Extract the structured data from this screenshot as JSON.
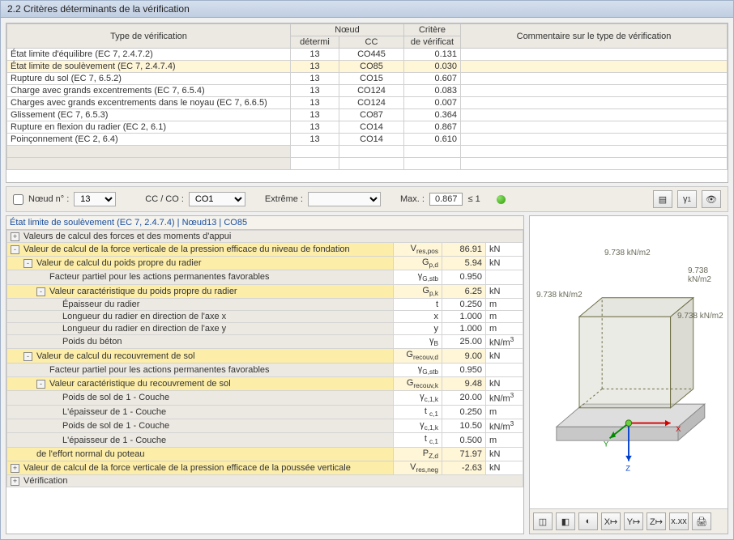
{
  "title": "2.2 Critères déterminants de la vérification",
  "table_headers": {
    "type": "Type de vérification",
    "noeud": "Nœud",
    "determi": "détermi",
    "cc": "CC",
    "critere": "Critère",
    "de_verificat": "de vérificat",
    "commentaire": "Commentaire sur le type de vérification"
  },
  "rows": [
    {
      "type": "État limite d'équilibre (EC 7, 2.4.7.2)",
      "det": "13",
      "cc": "CO445",
      "crit": "0.131",
      "hl": false
    },
    {
      "type": "État limite de soulèvement (EC 7, 2.4.7.4)",
      "det": "13",
      "cc": "CO85",
      "crit": "0.030",
      "hl": true
    },
    {
      "type": "Rupture du sol (EC 7, 6.5.2)",
      "det": "13",
      "cc": "CO15",
      "crit": "0.607",
      "hl": false
    },
    {
      "type": "Charge avec grands excentrements (EC 7, 6.5.4)",
      "det": "13",
      "cc": "CO124",
      "crit": "0.083",
      "hl": false
    },
    {
      "type": "Charges avec grands excentrements dans le noyau (EC 7, 6.6.5)",
      "det": "13",
      "cc": "CO124",
      "crit": "0.007",
      "hl": false
    },
    {
      "type": "Glissement (EC 7, 6.5.3)",
      "det": "13",
      "cc": "CO87",
      "crit": "0.364",
      "hl": false
    },
    {
      "type": "Rupture en flexion du radier (EC 2, 6.1)",
      "det": "13",
      "cc": "CO14",
      "crit": "0.867",
      "hl": false
    },
    {
      "type": "Poinçonnement (EC 2, 6.4)",
      "det": "13",
      "cc": "CO14",
      "crit": "0.610",
      "hl": false
    }
  ],
  "filter": {
    "noeud_label": "Nœud n° :",
    "noeud_value": "13",
    "cc_label": "CC / CO :",
    "cc_value": "CO1",
    "extreme_label": "Extrême :",
    "extreme_value": "",
    "max_label": "Max. :",
    "max_value": "0.867",
    "max_limit": "≤ 1"
  },
  "details_header": "État limite de soulèvement (EC 7, 2.4.7.4) | Nœud13 | CO85",
  "details": [
    {
      "indent": 0,
      "tw": "+",
      "label": "Valeurs de calcul des forces et des moments d'appui"
    },
    {
      "indent": 0,
      "tw": "-",
      "label": "Valeur de calcul de la force verticale de la pression efficace du niveau de fondation",
      "sym_html": "V<sub>res,pos</sub>",
      "val": "86.91",
      "unit": "kN",
      "hl": true
    },
    {
      "indent": 1,
      "tw": "-",
      "label": "Valeur de calcul du poids propre du radier",
      "sym_html": "G<sub>p,d</sub>",
      "val": "5.94",
      "unit": "kN",
      "hl": true
    },
    {
      "indent": 2,
      "tw": "",
      "label": "Facteur partiel pour les actions permanentes favorables",
      "sym_html": "γ<sub>G,stb</sub>",
      "val": "0.950",
      "unit": ""
    },
    {
      "indent": 2,
      "tw": "-",
      "label": "Valeur caractéristique du poids propre du radier",
      "sym_html": "G<sub>p,k</sub>",
      "val": "6.25",
      "unit": "kN",
      "hl": true
    },
    {
      "indent": 3,
      "tw": "",
      "label": "Épaisseur du radier",
      "sym_html": "t",
      "val": "0.250",
      "unit": "m"
    },
    {
      "indent": 3,
      "tw": "",
      "label": "Longueur du radier en direction de l'axe x",
      "sym_html": "x",
      "val": "1.000",
      "unit": "m"
    },
    {
      "indent": 3,
      "tw": "",
      "label": "Longueur du radier en direction de l'axe y",
      "sym_html": "y",
      "val": "1.000",
      "unit": "m"
    },
    {
      "indent": 3,
      "tw": "",
      "label": "Poids du béton",
      "sym_html": "γ<sub>B</sub>",
      "val": "25.00",
      "unit_html": "kN/m<sup>3</sup>"
    },
    {
      "indent": 1,
      "tw": "-",
      "label": "Valeur de calcul du recouvrement de sol",
      "sym_html": "G<sub>recouv,d</sub>",
      "val": "9.00",
      "unit": "kN",
      "hl": true
    },
    {
      "indent": 2,
      "tw": "",
      "label": "Facteur partiel pour les actions permanentes favorables",
      "sym_html": "γ<sub>G,stb</sub>",
      "val": "0.950",
      "unit": ""
    },
    {
      "indent": 2,
      "tw": "-",
      "label": "Valeur caractéristique du recouvrement de sol",
      "sym_html": "G<sub>recouv,k</sub>",
      "val": "9.48",
      "unit": "kN",
      "hl": true
    },
    {
      "indent": 3,
      "tw": "",
      "label": "Poids de sol de 1 - Couche",
      "sym_html": "γ<sub>c,1,k</sub>",
      "val": "20.00",
      "unit_html": "kN/m<sup>3</sup>"
    },
    {
      "indent": 3,
      "tw": "",
      "label": "L'épaisseur de 1 - Couche",
      "sym_html": "t <sub>c,1</sub>",
      "val": "0.250",
      "unit": "m"
    },
    {
      "indent": 3,
      "tw": "",
      "label": "Poids de sol de 1 - Couche",
      "sym_html": "γ<sub>c,1,k</sub>",
      "val": "10.50",
      "unit_html": "kN/m<sup>3</sup>"
    },
    {
      "indent": 3,
      "tw": "",
      "label": "L'épaisseur de 1 - Couche",
      "sym_html": "t <sub>c,1</sub>",
      "val": "0.500",
      "unit": "m"
    },
    {
      "indent": 1,
      "tw": "",
      "label": "de l'effort normal du poteau",
      "sym_html": "P<sub>Z,d</sub>",
      "val": "71.97",
      "unit": "kN",
      "hl": true
    },
    {
      "indent": 0,
      "tw": "+",
      "label": "Valeur de calcul de la force verticale de la pression efficace de la poussée verticale",
      "sym_html": "V<sub>res,neg</sub>",
      "val": "-2.63",
      "unit": "kN",
      "hl": true
    },
    {
      "indent": 0,
      "tw": "+",
      "label": "Vérification"
    }
  ],
  "viewer": {
    "loads": {
      "top": "9.738 kN/m2",
      "right": "9.738 kN/m2",
      "left": "9.738 kN/m2",
      "front": "9.738 kN/m2"
    },
    "axes": {
      "x": "X",
      "y": "Y",
      "z": "Z"
    }
  },
  "viewer_toolbar": [
    "◫",
    "◧",
    "◐",
    "X↦",
    "Y↦",
    "Z↦",
    "x.xx",
    "🖨"
  ]
}
